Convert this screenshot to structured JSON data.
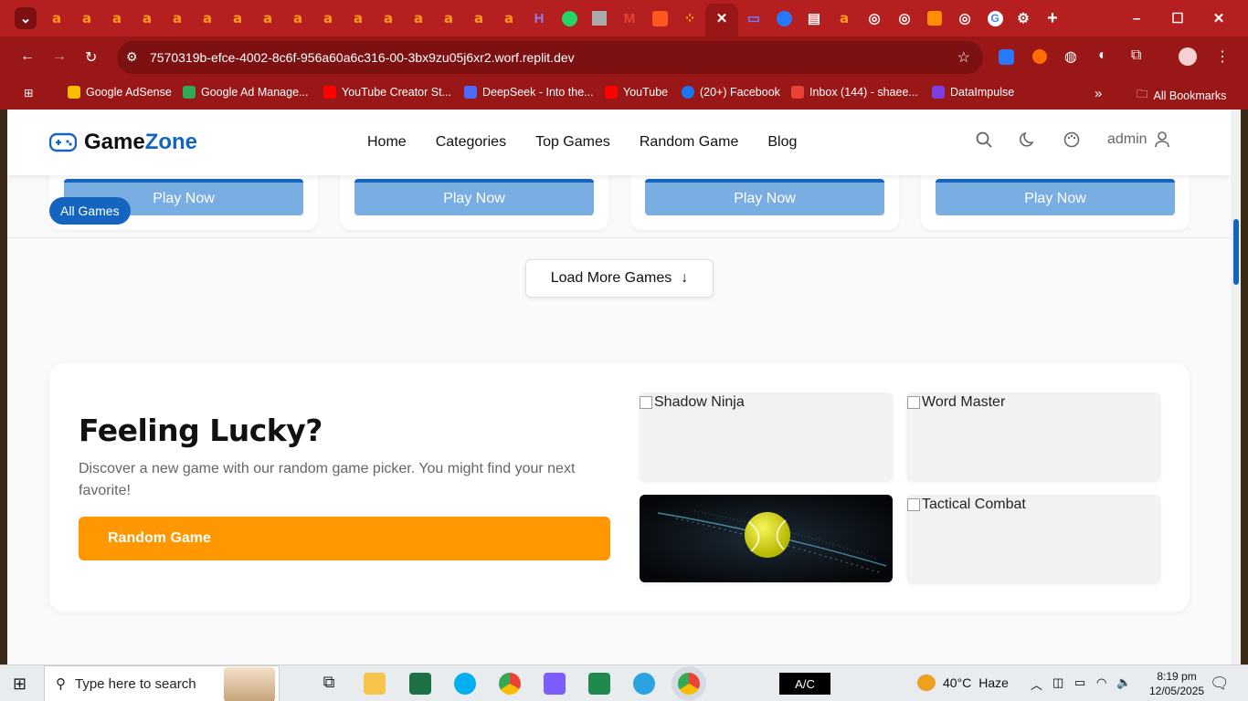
{
  "browser": {
    "url": "7570319b-efce-4002-8c6f-956a60a6c316-00-3bx9zu05j6xr2.worf.replit.dev",
    "bookmarks": [
      "Google AdSense",
      "Google Ad Manage...",
      "YouTube Creator St...",
      "DeepSeek - Into the...",
      "YouTube",
      "(20+) Facebook",
      "Inbox (144) - shaee...",
      "DataImpulse"
    ],
    "all_bookmarks": "All Bookmarks",
    "overflow": "»"
  },
  "site": {
    "logo_game": "Game",
    "logo_zone": "Zone",
    "nav": [
      "Home",
      "Categories",
      "Top Games",
      "Random Game",
      "Blog"
    ],
    "user": "admin"
  },
  "cards": {
    "play_label": "Play Now",
    "all_games_badge": "All Games"
  },
  "load_more": "Load More Games",
  "lucky": {
    "title": "Feeling Lucky?",
    "text": "Discover a new game with our random game picker. You might find your next favorite!",
    "button": "Random Game",
    "thumbs": [
      "Shadow Ninja",
      "Word Master",
      "Tactical Combat"
    ]
  },
  "taskbar": {
    "search_placeholder": "Type here to search",
    "ac": "A/C",
    "temperature": "40°C",
    "weather": "Haze",
    "time": "8:19 pm",
    "date": "12/05/2025"
  },
  "colors": {
    "chrome": "#b61f1f",
    "brand": "#1565c0",
    "accent": "#ff9800"
  }
}
